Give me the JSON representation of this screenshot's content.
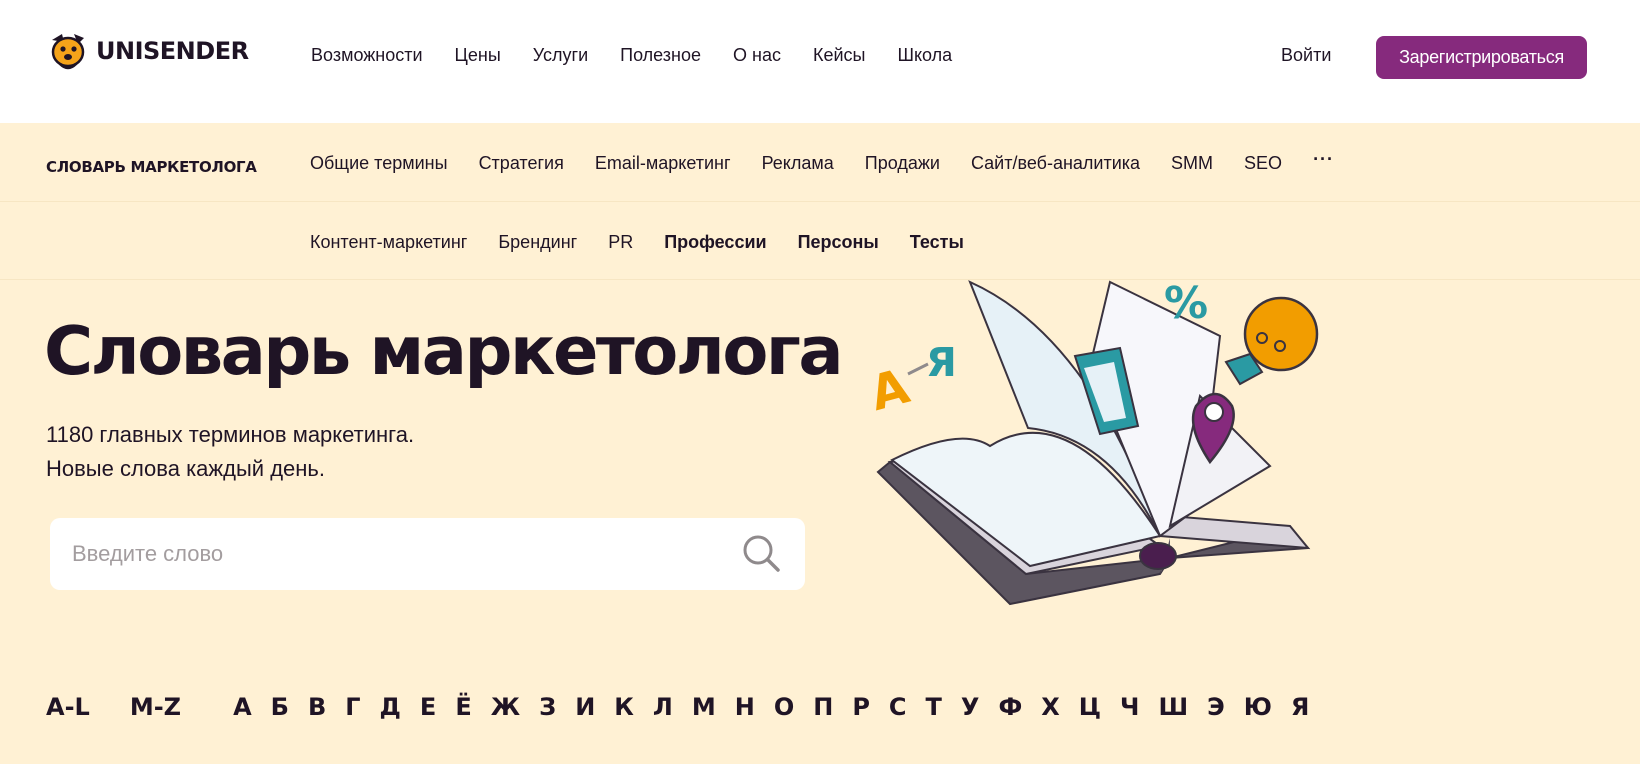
{
  "header": {
    "logo_text": "UNISENDER",
    "nav": [
      "Возможности",
      "Цены",
      "Услуги",
      "Полезное",
      "О нас",
      "Кейсы",
      "Школа"
    ],
    "login_label": "Войти",
    "signup_label": "Зарегистрироваться"
  },
  "dictionary_nav": {
    "brand": "СЛОВАРЬ МАРКЕТОЛОГА",
    "row1": [
      "Общие термины",
      "Стратегия",
      "Email-маркетинг",
      "Реклама",
      "Продажи",
      "Сайт/веб-аналитика",
      "SMM",
      "SEO"
    ],
    "more_label": "···",
    "row2": [
      {
        "label": "Контент-маркетинг",
        "bold": false
      },
      {
        "label": "Брендинг",
        "bold": false
      },
      {
        "label": "PR",
        "bold": false
      },
      {
        "label": "Профессии",
        "bold": true
      },
      {
        "label": "Персоны",
        "bold": true
      },
      {
        "label": "Тесты",
        "bold": true
      }
    ]
  },
  "hero": {
    "title": "Словарь маркетолога",
    "subtitle_line1": "1180 главных терминов маркетинга.",
    "subtitle_line2": "Новые слова каждый день.",
    "search_placeholder": "Введите слово",
    "search_value": ""
  },
  "illustration": {
    "letter_a": "А",
    "letter_ya": "Я",
    "percent": "%"
  },
  "alphabet": {
    "latin": [
      "A-L",
      "M-Z"
    ],
    "cyrillic": [
      "А",
      "Б",
      "В",
      "Г",
      "Д",
      "Е",
      "Ё",
      "Ж",
      "З",
      "И",
      "К",
      "Л",
      "М",
      "Н",
      "О",
      "П",
      "Р",
      "С",
      "Т",
      "У",
      "Ф",
      "Х",
      "Ц",
      "Ч",
      "Ш",
      "Э",
      "Ю",
      "Я"
    ]
  },
  "colors": {
    "brand_purple": "#862a7d",
    "beige_bg": "#fff1d4",
    "text_dark": "#1f1425",
    "accent_orange": "#f29d00",
    "accent_teal": "#2a9aa3"
  },
  "icons": [
    "unisender-dog-logo-icon",
    "search-icon",
    "more-dots-icon",
    "open-book-illustration",
    "lightbulb-icon",
    "map-pin-icon",
    "percent-icon"
  ]
}
